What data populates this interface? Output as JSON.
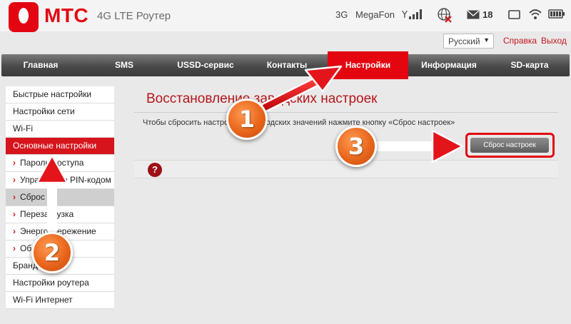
{
  "header": {
    "brand": "МТС",
    "product": "4G LTE Роутер",
    "network_type": "3G",
    "operator": "MegaFon",
    "sms_count": "18",
    "icons": [
      "signal-icon",
      "globe-icon",
      "envelope-icon",
      "battery-icon",
      "wifi-icon",
      "battery-level-icon"
    ]
  },
  "topbar": {
    "language": "Русский",
    "help_link": "Справка",
    "logout_link": "Выход"
  },
  "nav": {
    "items": [
      "Главная",
      "SMS",
      "USSD-сервис",
      "Контакты",
      "Настройки",
      "Информация",
      "SD-карта"
    ],
    "active": "Настройки"
  },
  "sidebar": {
    "items": [
      {
        "label": "Быстрые настройки"
      },
      {
        "label": "Настройки сети"
      },
      {
        "label": "Wi-Fi"
      },
      {
        "label": "Основные настройки"
      },
      {
        "label": "Пароль доступа"
      },
      {
        "label": "Управление PIN-кодом"
      },
      {
        "label": "Сброс"
      },
      {
        "label": "Перезагрузка"
      },
      {
        "label": "Энергосбережение"
      },
      {
        "label": "Обновление"
      },
      {
        "label": "Брандмауэр"
      },
      {
        "label": "Настройки роутера"
      },
      {
        "label": "Wi-Fi  Интернет"
      }
    ]
  },
  "main": {
    "title": "Восстановление заводских настроек",
    "instruction": "Чтобы сбросить настройки до заводских значений нажмите кнопку «Сброс настроек»",
    "reset_button": "Сброс настроек",
    "help_icon_glyph": "?"
  },
  "annotations": {
    "badge_1": "1",
    "badge_2": "2",
    "badge_3": "3"
  },
  "colors": {
    "brand_red": "#e30611",
    "nav_dark": "#4a4a4a",
    "arrow_red": "#e4141b",
    "badge_orange": "#e8661c"
  }
}
